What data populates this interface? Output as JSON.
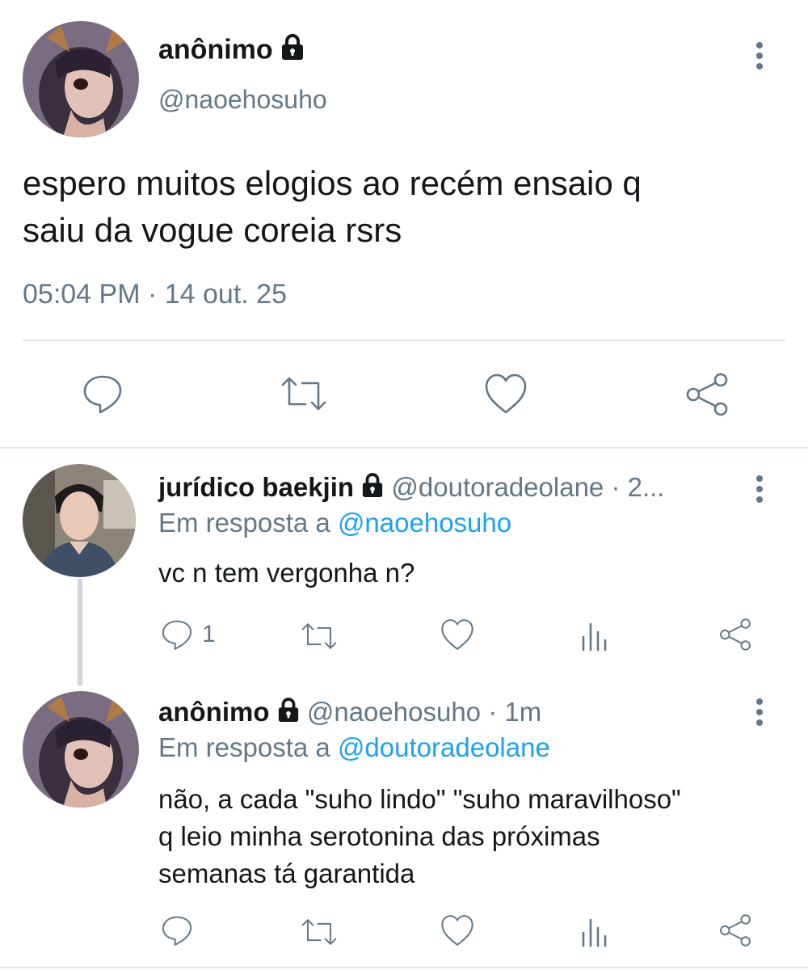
{
  "tweet": {
    "name": "anônimo",
    "handle": "@naoehosuho",
    "text_line1": "espero muitos elogios ao recém ensaio q",
    "text_line2": "saiu da vogue coreia rsrs",
    "timestamp": "05:04 PM · 14 out. 25"
  },
  "reply1": {
    "name": "jurídico baekjin",
    "meta": "@doutoradeolane · 2...",
    "reply_prefix": "Em resposta a",
    "reply_to": "@naoehosuho",
    "text": "vc n tem vergonha n?",
    "reply_count": "1"
  },
  "reply2": {
    "name": "anônimo",
    "meta": "@naoehosuho · 1m",
    "reply_prefix": "Em resposta a",
    "reply_to": "@doutoradeolane",
    "text_line1": "não, a cada \"suho lindo\" \"suho maravilhoso\"",
    "text_line2": "q leio minha serotonina das próximas",
    "text_line3": "semanas tá garantida"
  },
  "colors": {
    "text": "#14171a",
    "secondary": "#657786",
    "link": "#1da1f2",
    "divider": "#e1e8ed"
  }
}
